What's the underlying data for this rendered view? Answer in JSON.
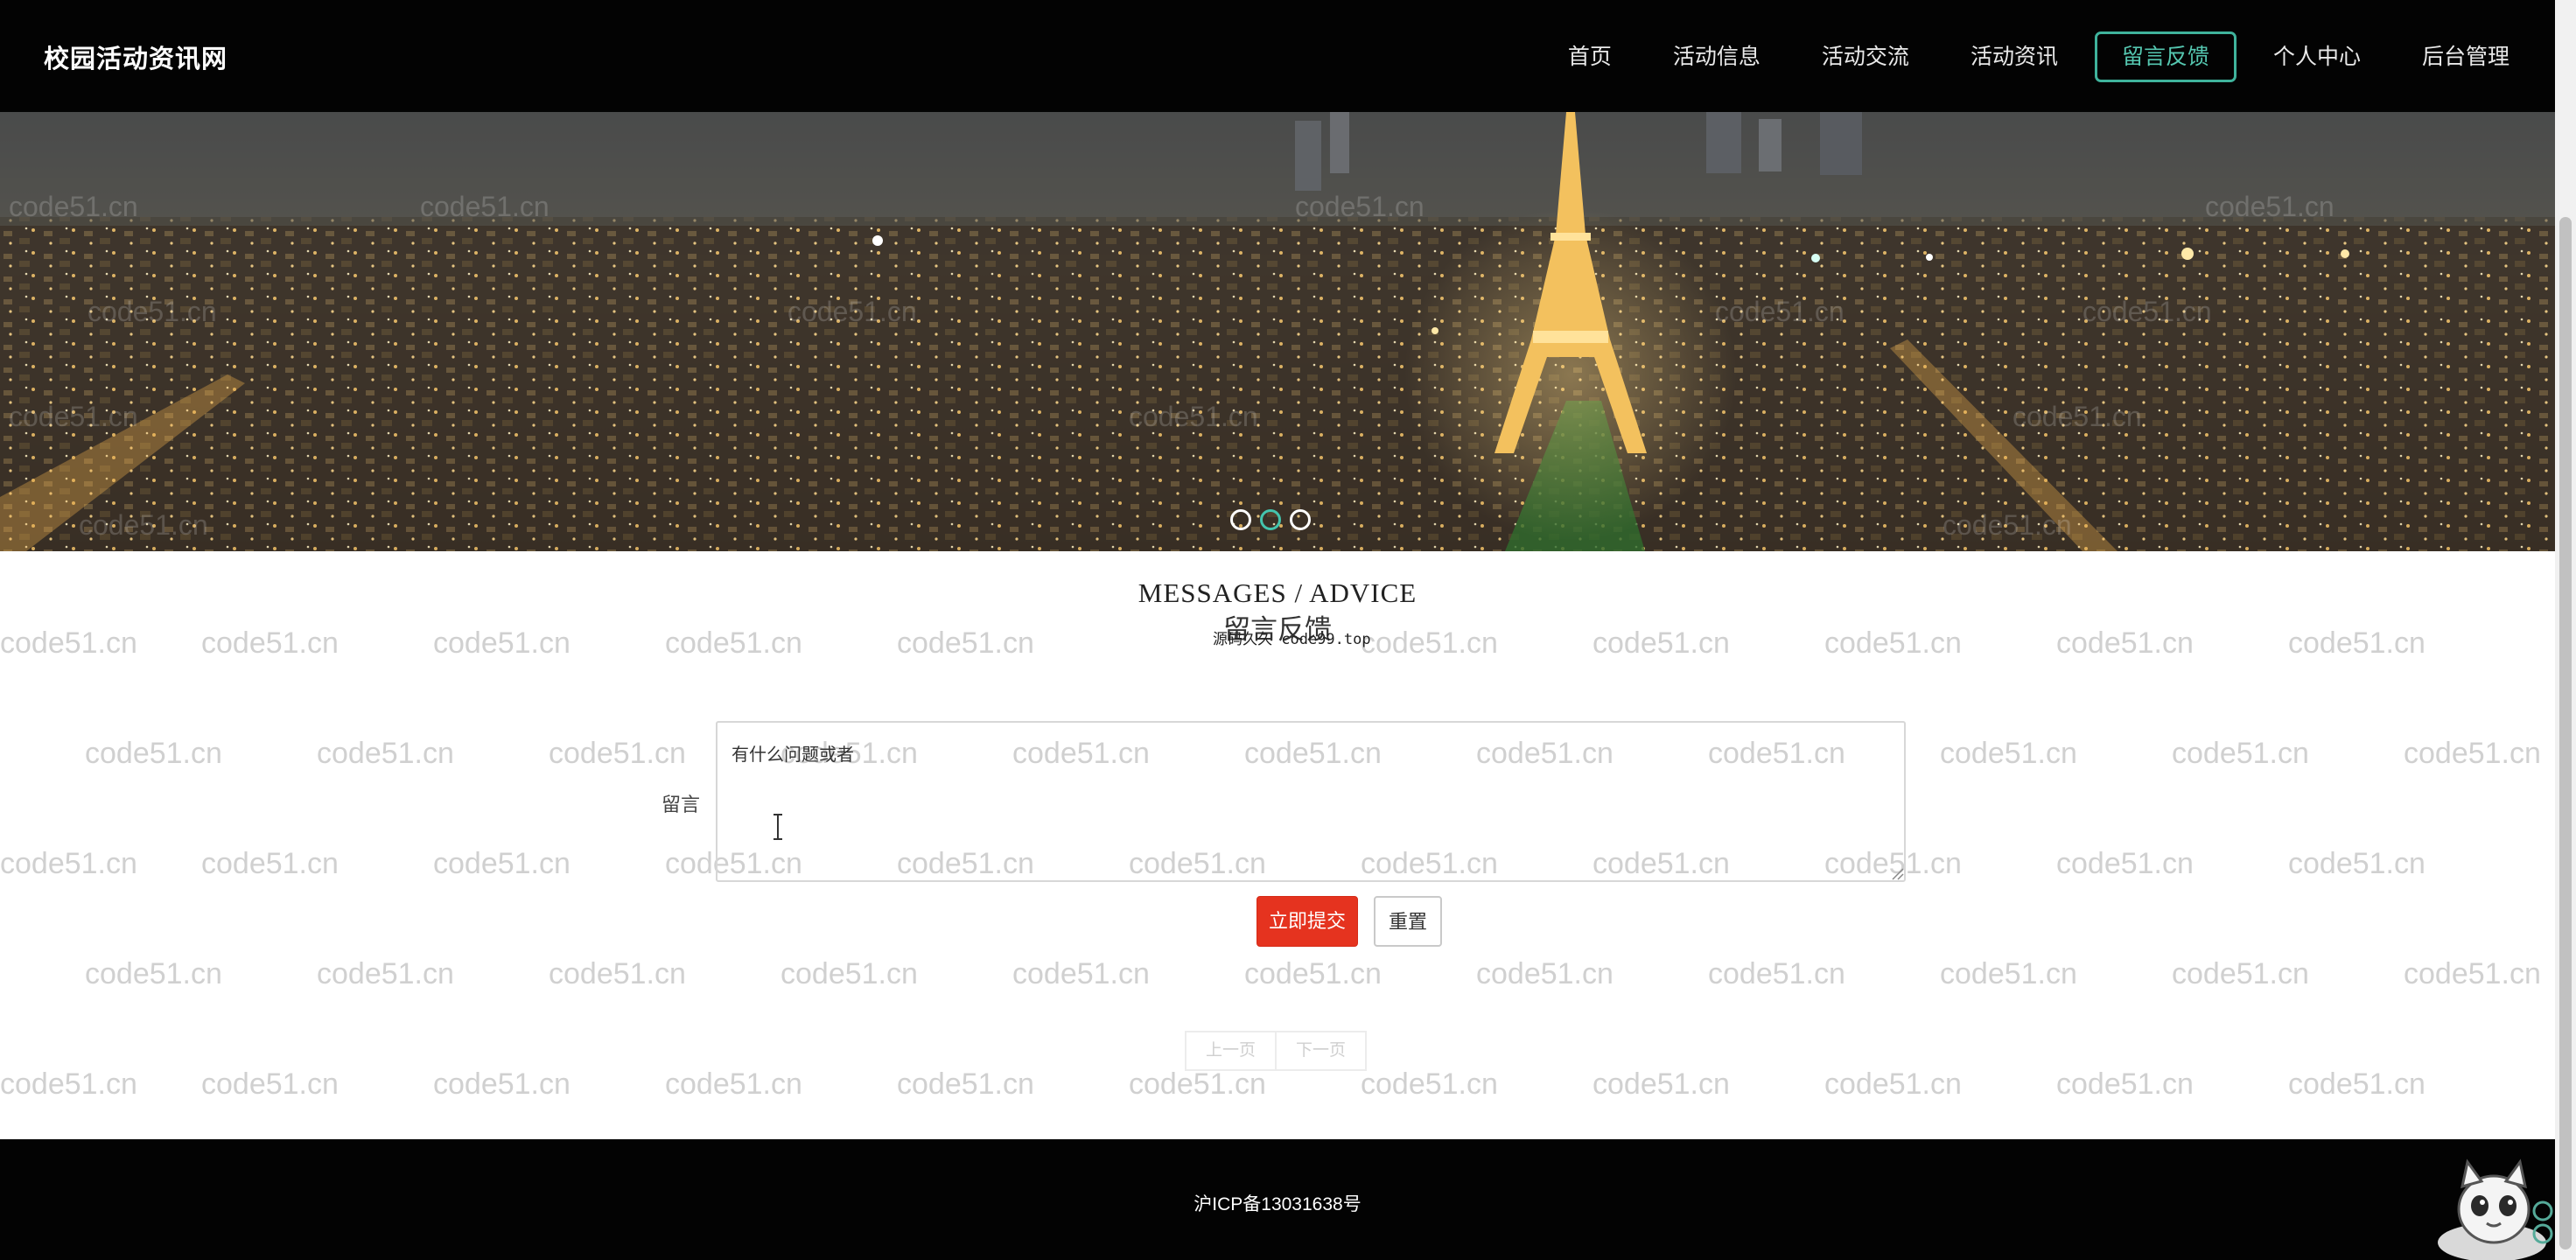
{
  "brand": {
    "title": "校园活动资讯网"
  },
  "nav": {
    "items": [
      {
        "label": "首页",
        "active": false
      },
      {
        "label": "活动信息",
        "active": false
      },
      {
        "label": "活动交流",
        "active": false
      },
      {
        "label": "活动资讯",
        "active": false
      },
      {
        "label": "留言反馈",
        "active": true
      },
      {
        "label": "个人中心",
        "active": false
      },
      {
        "label": "后台管理",
        "active": false
      }
    ]
  },
  "carousel": {
    "dots": 3,
    "active_index": 1
  },
  "section": {
    "title_en": "MESSAGES / ADVICE",
    "title_cn": "留言反馈",
    "overlay_text": "源码久久 code99.top"
  },
  "form": {
    "label": "留言",
    "textarea_value": "有什么问题或者"
  },
  "buttons": {
    "submit": "立即提交",
    "reset": "重置"
  },
  "pagination": {
    "prev": "上一页",
    "next": "下一页"
  },
  "footer": {
    "icp": "沪ICP备13031638号"
  },
  "watermark": {
    "text": "code51.cn"
  },
  "colors": {
    "accent": "#3fb39c",
    "submit": "#e5331f",
    "bar": "#030303"
  }
}
